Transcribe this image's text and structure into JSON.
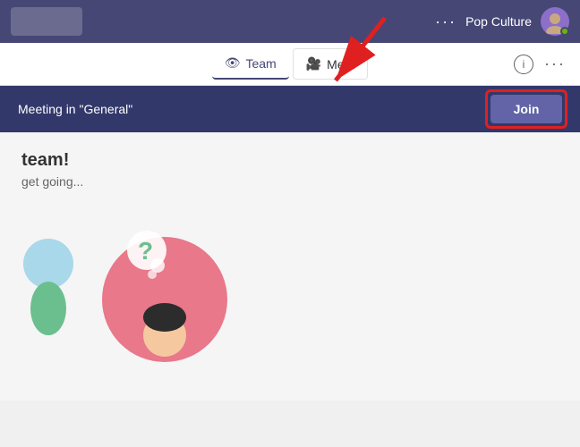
{
  "header": {
    "dots_label": "···",
    "channel_name": "Pop Culture",
    "avatar_status": "online"
  },
  "tabs": {
    "team_label": "Team",
    "meet_label": "Meet",
    "info_label": "i",
    "more_label": "···"
  },
  "meeting": {
    "title": "Meeting in \"General\"",
    "join_label": "Join"
  },
  "content": {
    "welcome": "team!",
    "subtitle": "get going..."
  }
}
